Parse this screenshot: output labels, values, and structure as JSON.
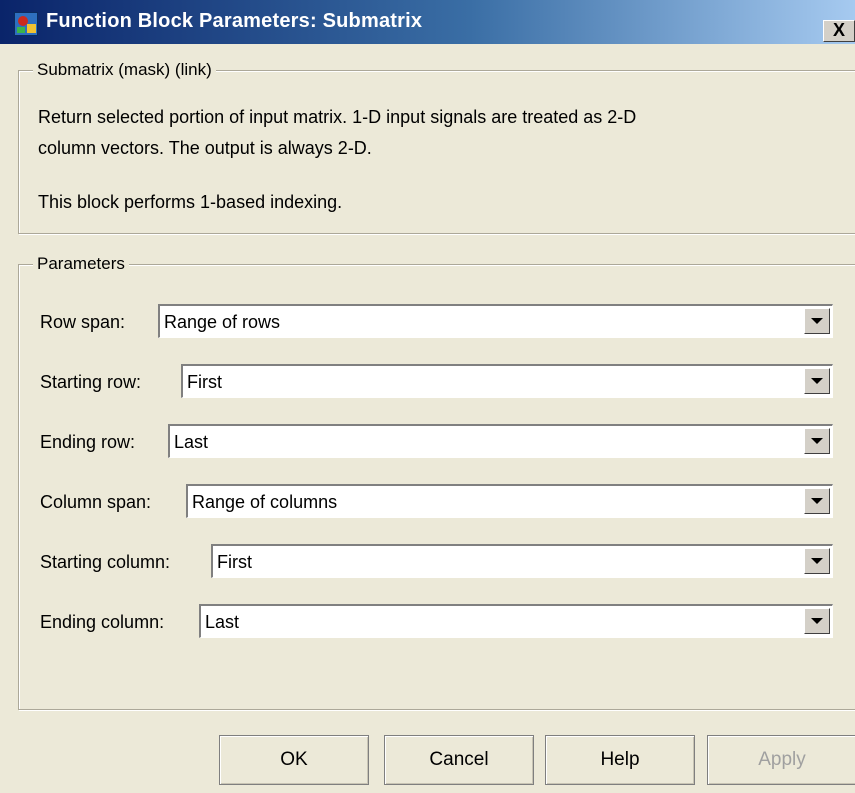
{
  "window": {
    "title": "Function Block Parameters: Submatrix",
    "close_label": "X",
    "icon": "simulink-block-icon"
  },
  "description": {
    "group_label": "Submatrix (mask) (link)",
    "line1": "Return selected portion of input matrix.  1-D input signals are treated as 2-D",
    "line2": "column vectors.  The output is always 2-D.",
    "line3": "This block performs 1-based indexing."
  },
  "parameters": {
    "group_label": "Parameters",
    "fields": [
      {
        "label": "Row span:",
        "value": "Range of rows"
      },
      {
        "label": "Starting row:",
        "value": "First"
      },
      {
        "label": "Ending row:",
        "value": "Last"
      },
      {
        "label": "Column span:",
        "value": "Range of columns"
      },
      {
        "label": "Starting column:",
        "value": "First"
      },
      {
        "label": "Ending column:",
        "value": "Last"
      }
    ]
  },
  "buttons": {
    "ok": "OK",
    "cancel": "Cancel",
    "help": "Help",
    "apply": "Apply"
  }
}
